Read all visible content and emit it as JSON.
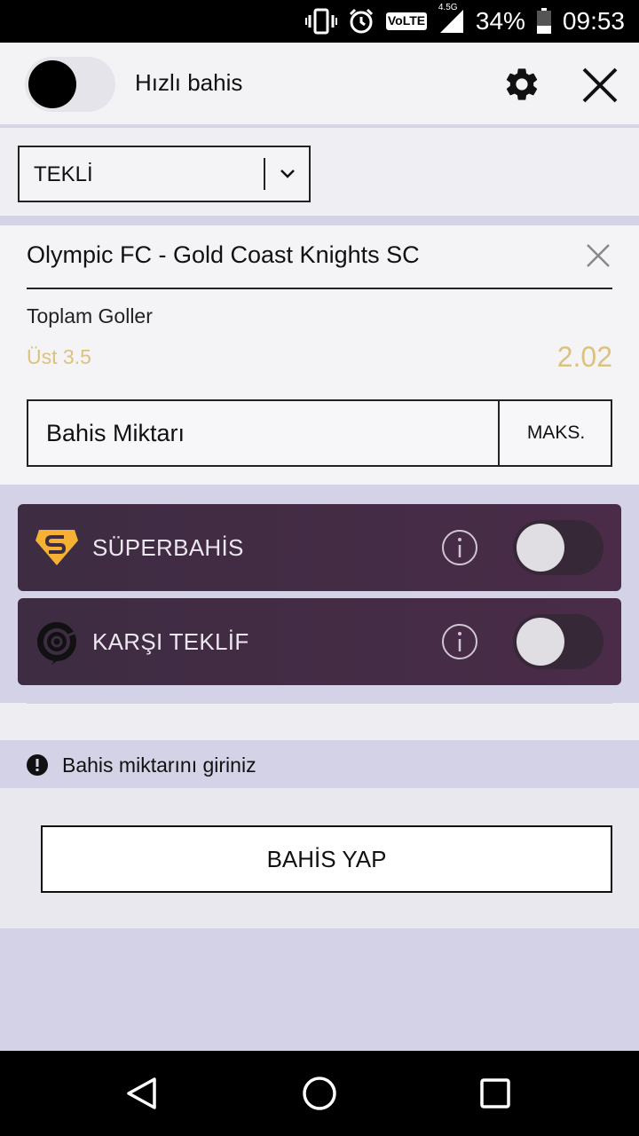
{
  "status_bar": {
    "network": "4.5G",
    "volte": "VoLTE",
    "battery": "34%",
    "time": "09:53"
  },
  "header": {
    "quick_bet_label": "Hızlı bahis",
    "quick_bet_enabled": false
  },
  "bet_type": {
    "selected": "TEKLİ"
  },
  "bet": {
    "match": "Olympic FC - Gold Coast Knights SC",
    "market": "Toplam Goller",
    "selection": "Üst 3.5",
    "odds": "2.02",
    "stake_placeholder": "Bahis Miktarı",
    "max_label": "MAKS."
  },
  "features": [
    {
      "label": "SÜPERBAHİS",
      "icon": "superbet-icon",
      "enabled": false
    },
    {
      "label": "KARŞI TEKLİF",
      "icon": "counter-offer-icon",
      "enabled": false
    }
  ],
  "warning": {
    "text": "Bahis miktarını giriniz"
  },
  "place_bet": {
    "label": "BAHİS YAP"
  },
  "colors": {
    "accent_gold": "#dbc27e",
    "feature_bg": "#4a2c48",
    "page_bg": "#d3d2e6"
  }
}
